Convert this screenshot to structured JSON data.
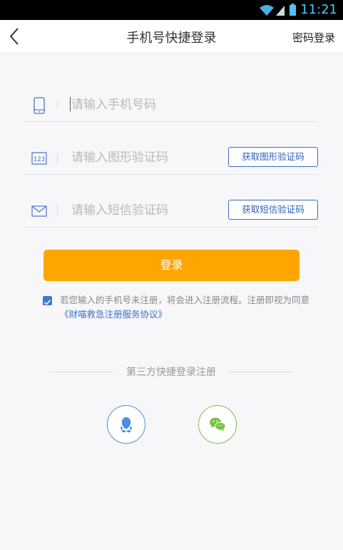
{
  "status_bar": {
    "time": "11:21"
  },
  "header": {
    "title": "手机号快捷登录",
    "right_link": "密码登录"
  },
  "form": {
    "phone": {
      "placeholder": "请输入手机号码"
    },
    "captcha": {
      "placeholder": "请输入图形验证码",
      "button": "获取图形验证码"
    },
    "sms": {
      "placeholder": "请输入短信验证码",
      "button": "获取短信验证码"
    },
    "login_button": "登录"
  },
  "agreement": {
    "checked": true,
    "text": "若您输入的手机号未注册，将会进入注册流程。注册即视为同意",
    "link": "《财喵救急注册服务协议》"
  },
  "third_party": {
    "title": "第三方快捷登录注册",
    "options": [
      "qq-icon",
      "wechat-icon"
    ]
  },
  "colors": {
    "accent": "#ffa500",
    "link": "#3a6fc9",
    "qq": "#4a90e2",
    "wechat": "#7ac143"
  }
}
